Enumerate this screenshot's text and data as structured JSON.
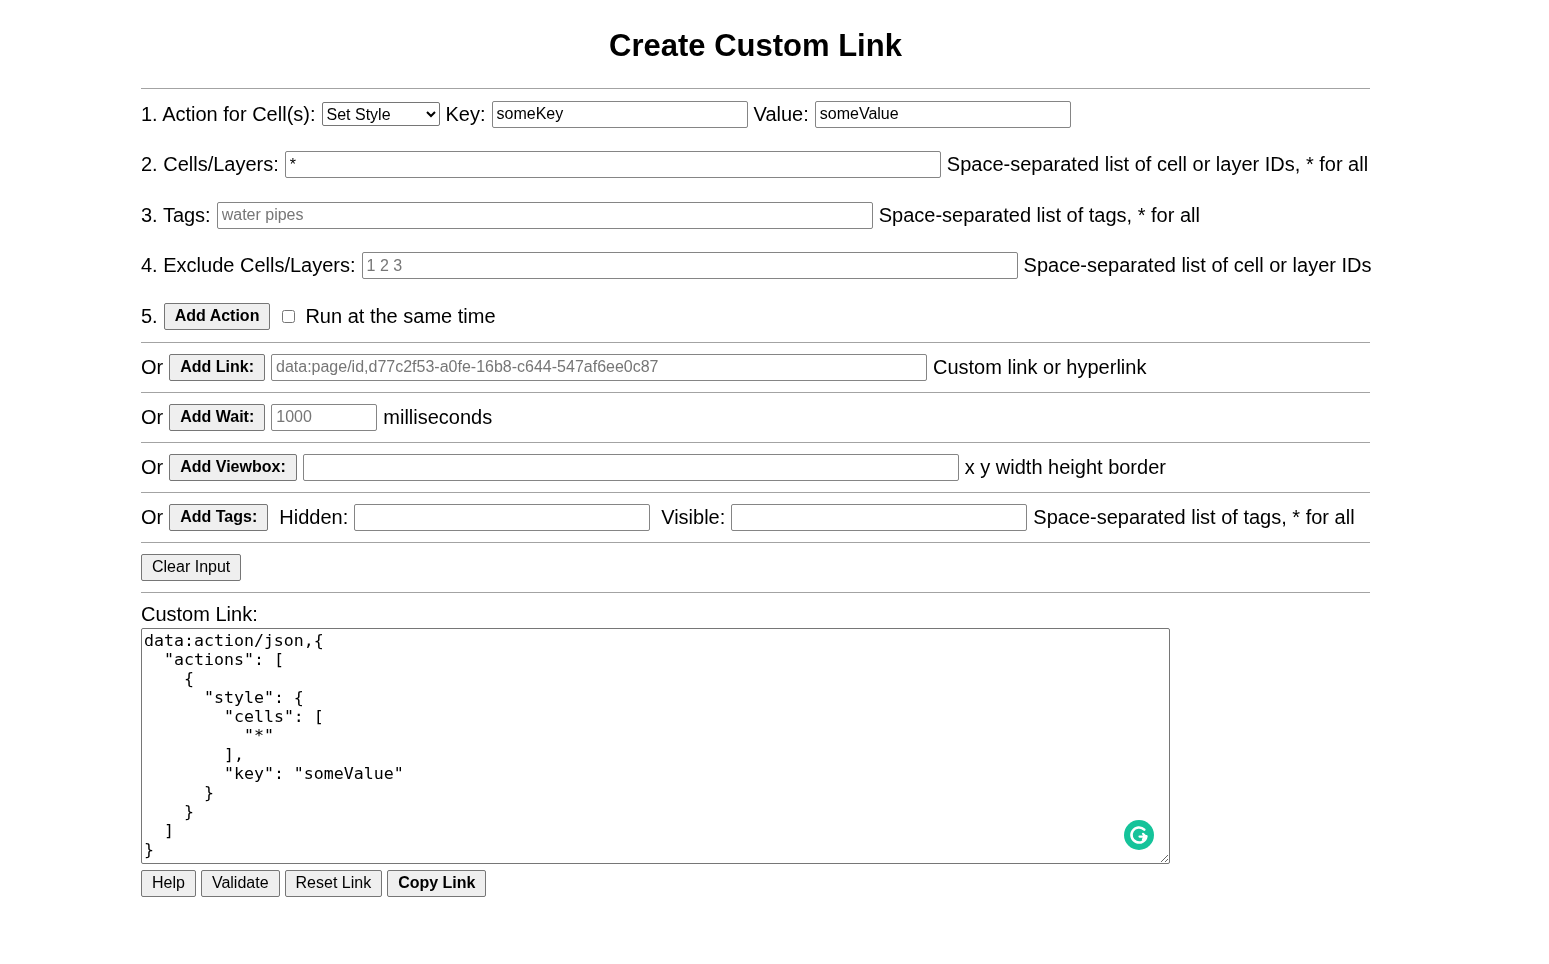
{
  "title": "Create Custom Link",
  "steps": {
    "action": {
      "label": "1. Action for Cell(s):",
      "selected_action": "Set Style",
      "key_label": "Key:",
      "key": {
        "value": "someKey"
      },
      "value_label": "Value:",
      "value": {
        "value": "someValue"
      }
    },
    "cells": {
      "label": "2. Cells/Layers:",
      "input": {
        "value": "*"
      },
      "hint": "Space-separated list of cell or layer IDs, * for all"
    },
    "tags": {
      "label": "3. Tags:",
      "input": {
        "placeholder": "water pipes"
      },
      "hint": "Space-separated list of tags, * for all"
    },
    "exclude": {
      "label": "4. Exclude Cells/Layers:",
      "input": {
        "placeholder": "1 2 3"
      },
      "hint": "Space-separated list of cell or layer IDs"
    },
    "add_action": {
      "number": "5.",
      "button": "Add Action",
      "checkbox": {
        "label": "Run at the same time",
        "checked": false
      }
    }
  },
  "alternatives": [
    {
      "kind": "link",
      "or": "Or",
      "button": "Add Link:",
      "input": {
        "placeholder": "data:page/id,d77c2f53-a0fe-16b8-c644-547af6ee0c87"
      },
      "hint": "Custom link or hyperlink"
    },
    {
      "kind": "wait",
      "or": "Or",
      "button": "Add Wait:",
      "input": {
        "placeholder": "1000"
      },
      "hint": "milliseconds"
    },
    {
      "kind": "viewbox",
      "or": "Or",
      "button": "Add Viewbox:",
      "hint": "x y width height border"
    },
    {
      "kind": "tags",
      "or": "Or",
      "button": "Add Tags:",
      "hidden_label": "Hidden:",
      "visible_label": "Visible:",
      "hint": "Space-separated list of tags, * for all"
    }
  ],
  "clear_button": "Clear Input",
  "custom_link": {
    "label": "Custom Link:",
    "text": "data:action/json,{\n  \"actions\": [\n    {\n      \"style\": {\n        \"cells\": [\n          \"*\"\n        ],\n        \"key\": \"someValue\"\n      }\n    }\n  ]\n}"
  },
  "buttons": [
    {
      "kind": "plain",
      "label": "Help"
    },
    {
      "kind": "plain",
      "label": "Validate"
    },
    {
      "kind": "plain",
      "label": "Reset Link"
    },
    {
      "kind": "primary",
      "label": "Copy Link"
    }
  ]
}
